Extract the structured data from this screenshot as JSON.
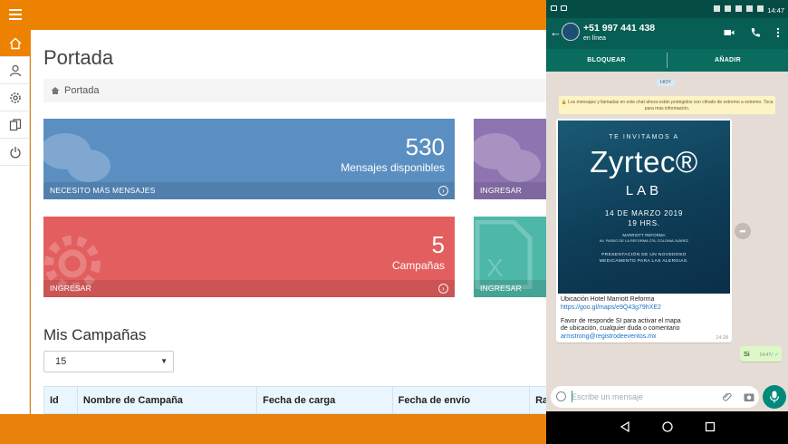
{
  "dashboard": {
    "page_title": "Portada",
    "breadcrumb": "Portada",
    "cards": [
      {
        "number": "530",
        "label": "Mensajes disponibles",
        "footer": "NECESITO MÁS MENSAJES",
        "color": "#5b8fc2"
      },
      {
        "footer": "INGRESAR",
        "color": "#8e74b0"
      },
      {
        "number": "5",
        "label": "Campañas",
        "footer": "INGRESAR",
        "color": "#e35e5e"
      },
      {
        "footer": "INGRESAR",
        "color": "#4db7a8"
      }
    ],
    "section_title": "Mis Campañas",
    "page_size": "15",
    "table_headers": [
      "Id",
      "Nombre de Campaña",
      "Fecha de carga",
      "Fecha de envío",
      "Ra"
    ]
  },
  "colors": {
    "accent": "#ed8200",
    "whatsapp": "#075e54"
  },
  "phone": {
    "status_time": "14:47",
    "contact": "+51 997 441 438",
    "presence": "en línea",
    "actions": [
      "BLOQUEAR",
      "AÑADIR"
    ],
    "day_label": "HOY",
    "e2e_notice": "🔒 Los mensajes y llamadas en este chat ahora están protegidos con cifrado de extremo a extremo. Toca para más información.",
    "invite": {
      "header": "TE INVITAMOS A",
      "brand": "Zyrtec®",
      "sub": "LAB",
      "date": "14 DE MARZO 2019",
      "hours": "19 HRS.",
      "venue": "MARRIOTT REFORMA",
      "address": "AV. PASEO DE LA REFORMA 276, COLONIA JUÁREZ",
      "presentation": "PRESENTACIÓN DE UN NOVEDOSO MEDICAMENTO PARA LAS ALERGIAS."
    },
    "message_lines": {
      "location": "Ubicación Hotel Marriott Reforma",
      "link": "https://goo.gl/maps/e9Q43g79hXE2",
      "favor1": "Favor de responde SI para activar el mapa",
      "favor2": "de ubicación, cualquier duda o comentario",
      "email": "armstrong@registrodeeventos.mx",
      "time": "14:28"
    },
    "reply": {
      "text": "Si",
      "time": "14:47",
      "ticks": "✓✓"
    },
    "input_placeholder": "Escribe un mensaje"
  }
}
